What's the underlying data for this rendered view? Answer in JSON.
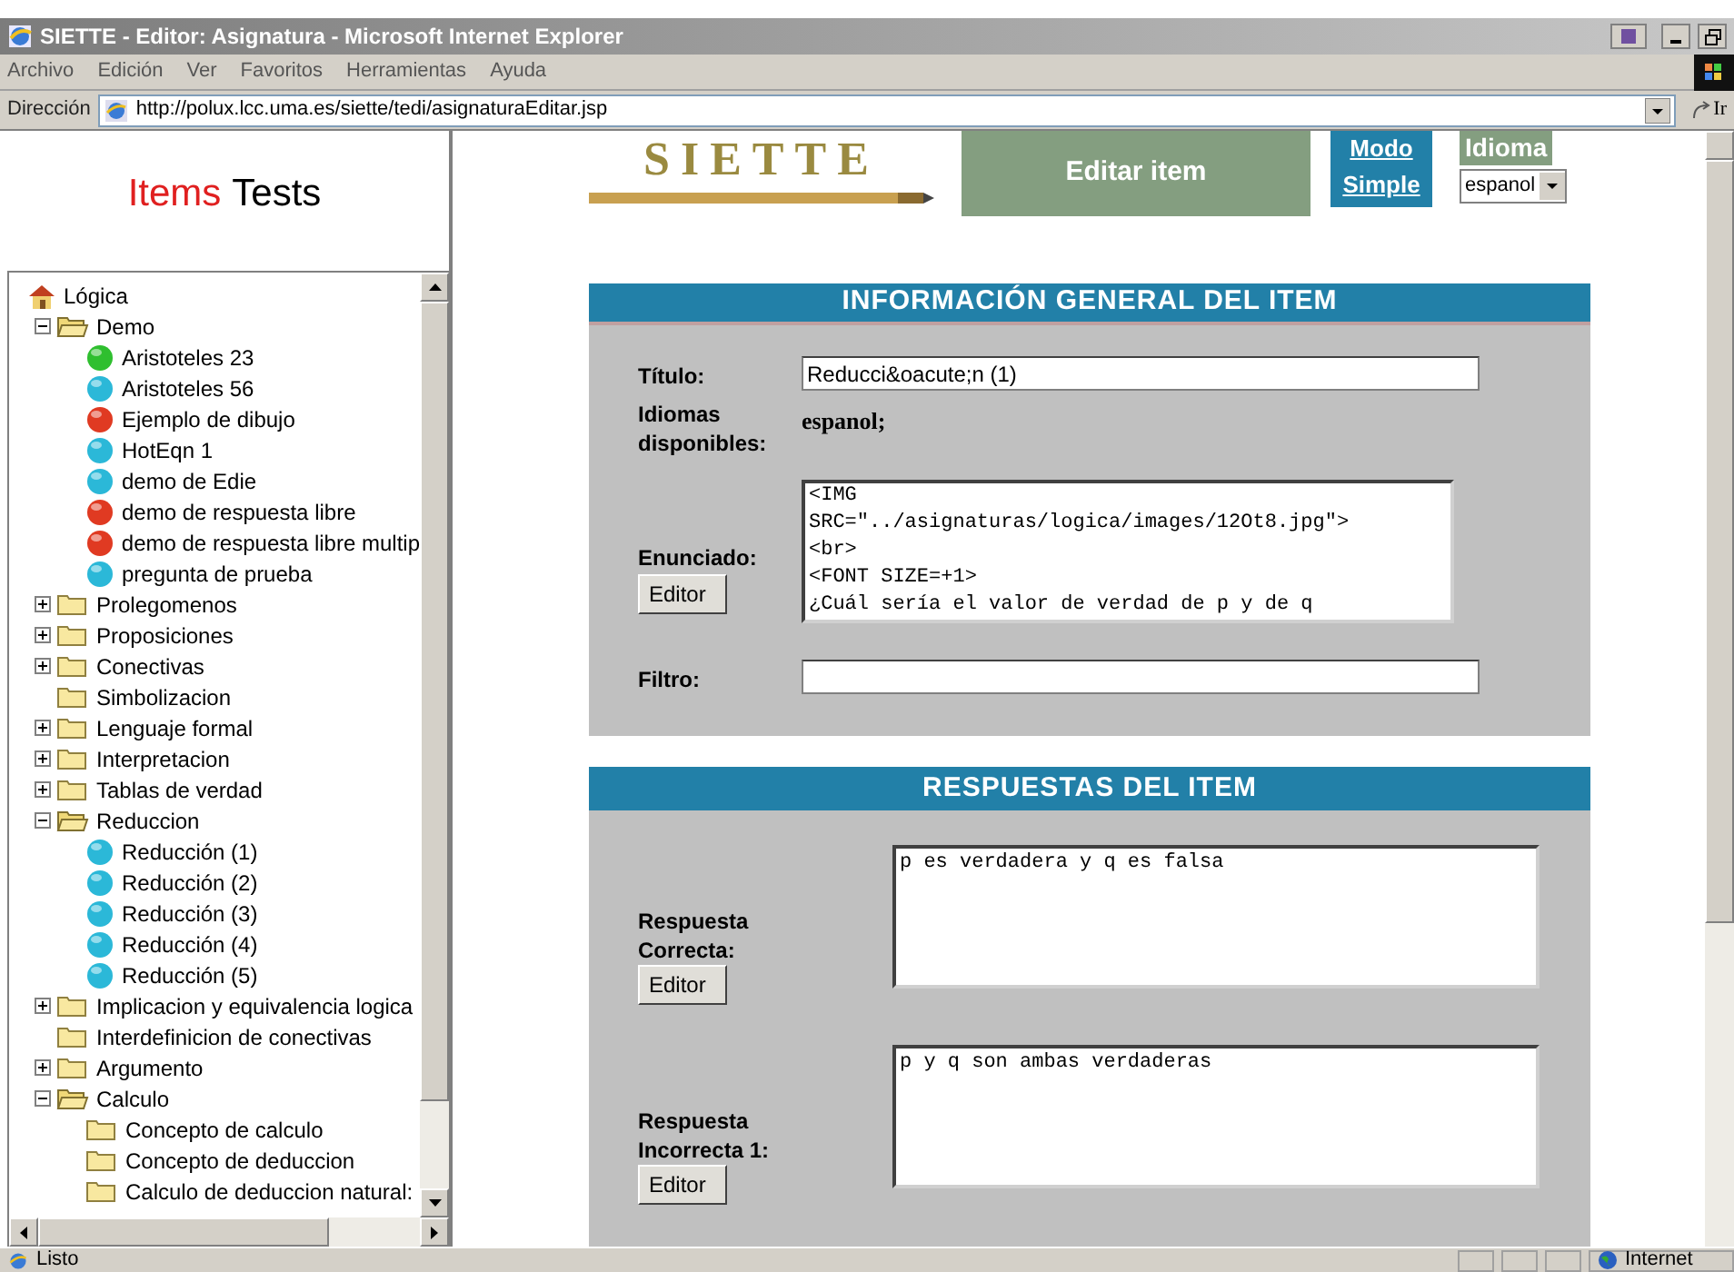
{
  "window": {
    "title": "SIETTE - Editor: Asignatura - Microsoft Internet Explorer"
  },
  "menu": [
    "Archivo",
    "Edición",
    "Ver",
    "Favoritos",
    "Herramientas",
    "Ayuda"
  ],
  "address": {
    "label": "Dirección",
    "url": "http://polux.lcc.uma.es/siette/tedi/asignaturaEditar.jsp",
    "go": "Ir"
  },
  "left_frame": {
    "tabs": [
      {
        "label": "Items",
        "selected": true
      },
      {
        "label": "Tests",
        "selected": false
      }
    ],
    "tree": {
      "label": "Lógica",
      "kind": "root",
      "children": [
        {
          "label": "Demo",
          "kind": "folder",
          "expanded": true,
          "children": [
            {
              "label": "Aristoteles 23",
              "kind": "item",
              "color": "#2fbf2f"
            },
            {
              "label": "Aristoteles 56",
              "kind": "item",
              "color": "#2bb8d8"
            },
            {
              "label": "Ejemplo de dibujo",
              "kind": "item",
              "color": "#e03a22"
            },
            {
              "label": "HotEqn 1",
              "kind": "item",
              "color": "#2bb8d8"
            },
            {
              "label": "demo de Edie",
              "kind": "item",
              "color": "#2bb8d8"
            },
            {
              "label": "demo de respuesta libre",
              "kind": "item",
              "color": "#e03a22"
            },
            {
              "label": "demo de respuesta libre multip",
              "kind": "item",
              "color": "#e03a22"
            },
            {
              "label": "pregunta de prueba",
              "kind": "item",
              "color": "#2bb8d8"
            }
          ]
        },
        {
          "label": "Prolegomenos",
          "kind": "folder",
          "expanded": false
        },
        {
          "label": "Proposiciones",
          "kind": "folder",
          "expanded": false
        },
        {
          "label": "Conectivas",
          "kind": "folder",
          "expanded": false
        },
        {
          "label": "Simbolizacion",
          "kind": "leaf-folder"
        },
        {
          "label": "Lenguaje formal",
          "kind": "folder",
          "expanded": false
        },
        {
          "label": "Interpretacion",
          "kind": "folder",
          "expanded": false
        },
        {
          "label": "Tablas de verdad",
          "kind": "folder",
          "expanded": false
        },
        {
          "label": "Reduccion",
          "kind": "folder",
          "expanded": true,
          "children": [
            {
              "label": "Reducción (1)",
              "kind": "item",
              "color": "#2bb8d8"
            },
            {
              "label": "Reducción (2)",
              "kind": "item",
              "color": "#2bb8d8"
            },
            {
              "label": "Reducción (3)",
              "kind": "item",
              "color": "#2bb8d8"
            },
            {
              "label": "Reducción (4)",
              "kind": "item",
              "color": "#2bb8d8"
            },
            {
              "label": "Reducción (5)",
              "kind": "item",
              "color": "#2bb8d8"
            }
          ]
        },
        {
          "label": "Implicacion y equivalencia logica",
          "kind": "folder",
          "expanded": false
        },
        {
          "label": "Interdefinicion de conectivas",
          "kind": "leaf-folder"
        },
        {
          "label": "Argumento",
          "kind": "folder",
          "expanded": false
        },
        {
          "label": "Calculo",
          "kind": "folder",
          "expanded": true,
          "children": [
            {
              "label": "Concepto de calculo",
              "kind": "leaf-folder"
            },
            {
              "label": "Concepto de deduccion",
              "kind": "leaf-folder"
            },
            {
              "label": "Calculo de deduccion natural:",
              "kind": "leaf-folder"
            }
          ]
        }
      ]
    }
  },
  "header": {
    "logo": "SIETTE",
    "title": "Editar item",
    "mode_link": "Modo Simple",
    "language": {
      "label": "Idioma",
      "value": "espanol"
    }
  },
  "general": {
    "heading": "INFORMACIÓN GENERAL DEL ITEM",
    "title_label": "Título:",
    "title_value": "Reducci&oacute;n (1)",
    "languages_label": "Idiomas disponibles:",
    "languages_value": "espanol;",
    "statement_label": "Enunciado:",
    "statement_button": "Editor",
    "statement_value": "<IMG\nSRC=\"../asignaturas/logica/images/12Ot8.jpg\">\n<br>\n<FONT SIZE=+1>\n¿Cuál sería el valor de verdad de p y de q",
    "filter_label": "Filtro:"
  },
  "answers": {
    "heading": "RESPUESTAS DEL ITEM",
    "items": [
      {
        "label": "Respuesta Correcta:",
        "button": "Editor",
        "value": "p es verdadera y q es falsa"
      },
      {
        "label": "Respuesta Incorrecta 1:",
        "button": "Editor",
        "value": "p y q son ambas verdaderas"
      }
    ]
  },
  "status_bar": {
    "text": "Listo",
    "zone": "Internet"
  }
}
